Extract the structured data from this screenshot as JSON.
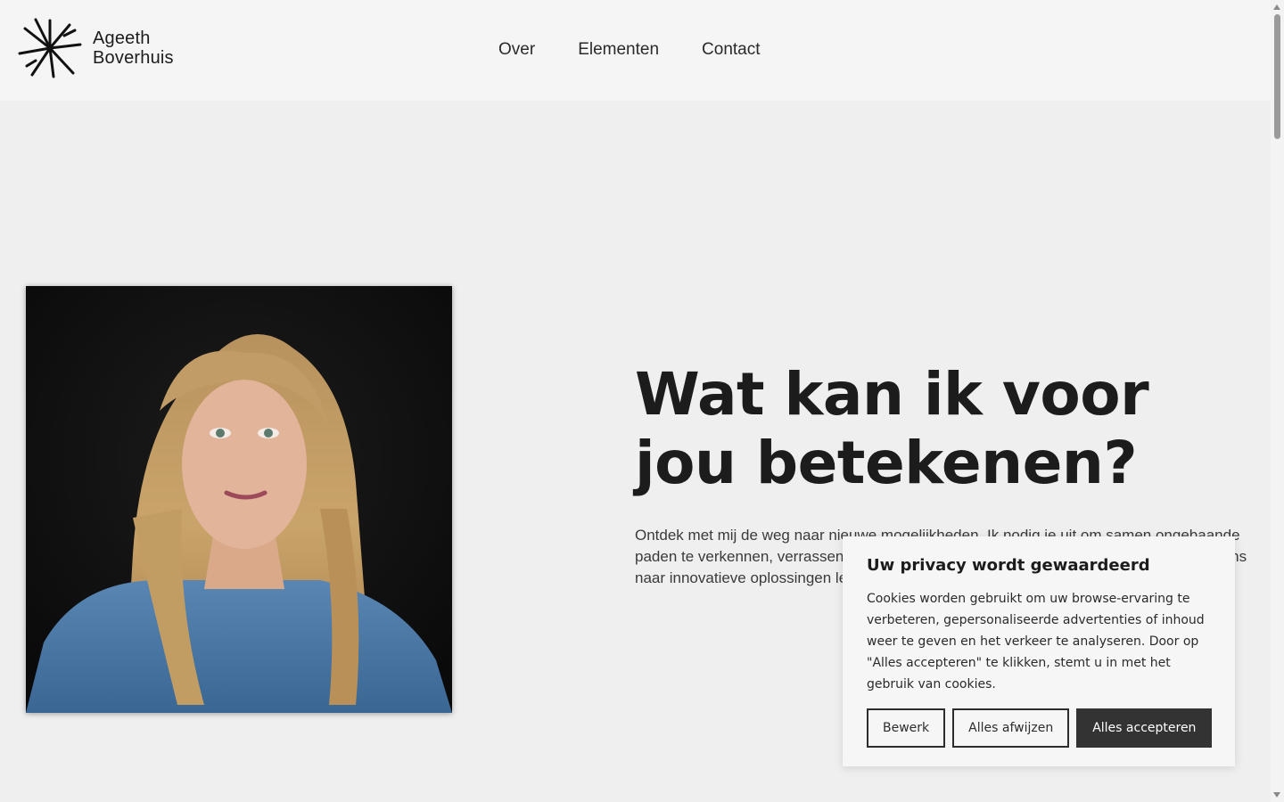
{
  "header": {
    "logo": {
      "line1": "Ageeth",
      "line2": "Boverhuis"
    },
    "nav": [
      {
        "label": "Over"
      },
      {
        "label": "Elementen"
      },
      {
        "label": "Contact"
      }
    ]
  },
  "hero": {
    "headline": "Wat kan ik voor jou betekenen?",
    "intro": "Ontdek met mij de weg naar nieuwe mogelijkheden. Ik nodig je uit om samen ongebaande paden te verkennen, verrassende inzichten te delen en perspectieven te ontdekken die ons naar innovatieve oplossingen leiden. Ik ga uitdagingen niet uit de weg, maar omarm ze."
  },
  "cookie_banner": {
    "title": "Uw privacy wordt gewaardeerd",
    "text": "Cookies worden gebruikt om uw browse-ervaring te verbeteren, gepersonaliseerde advertenties of inhoud weer te geven en het verkeer te analyseren. Door op \"Alles accepteren\" te klikken, stemt u in met het gebruik van cookies.",
    "buttons": {
      "customize": "Bewerk",
      "reject": "Alles afwijzen",
      "accept": "Alles accepteren"
    }
  },
  "colors": {
    "page_background": "#efefef",
    "header_background": "#f5f5f5",
    "text": "#1c1c1c",
    "accept_button": "#333333"
  }
}
